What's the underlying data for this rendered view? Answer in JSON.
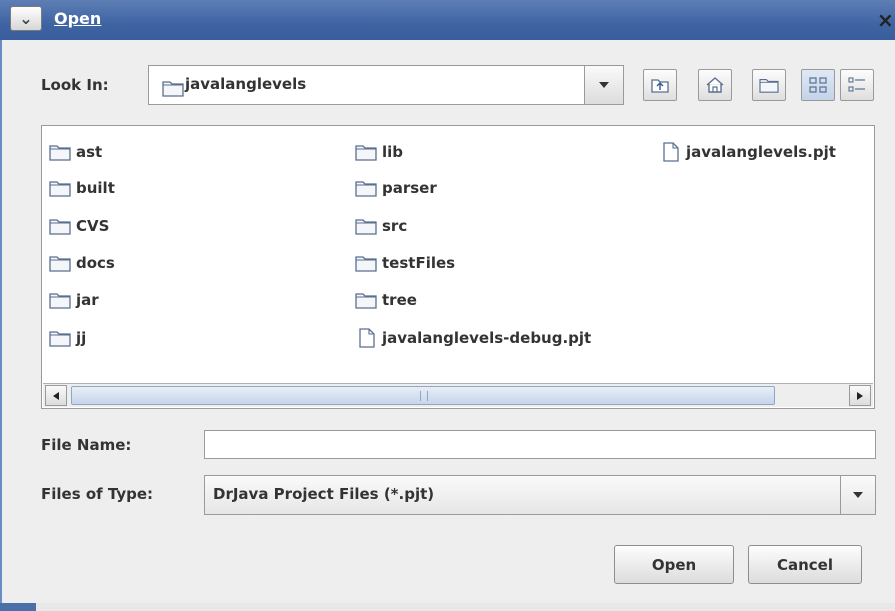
{
  "window": {
    "title": "Open",
    "close_glyph": "×"
  },
  "look_in": {
    "label": "Look In:",
    "value": "javalanglevels"
  },
  "toolbar": [
    "up-one-level-icon",
    "home-icon",
    "new-folder-icon",
    "list-view-icon",
    "details-view-icon"
  ],
  "files": {
    "col1": [
      "ast",
      "built",
      "CVS",
      "docs",
      "jar",
      "jj"
    ],
    "col2": [
      "lib",
      "parser",
      "src",
      "testFiles",
      "tree"
    ],
    "col2_file": "javalanglevels-debug.pjt",
    "col3_file": "javalanglevels.pjt"
  },
  "file_name": {
    "label": "File Name:",
    "value": ""
  },
  "file_type": {
    "label": "Files of Type:",
    "value": "DrJava Project Files (*.pjt)"
  },
  "buttons": {
    "open": "Open",
    "cancel": "Cancel"
  }
}
